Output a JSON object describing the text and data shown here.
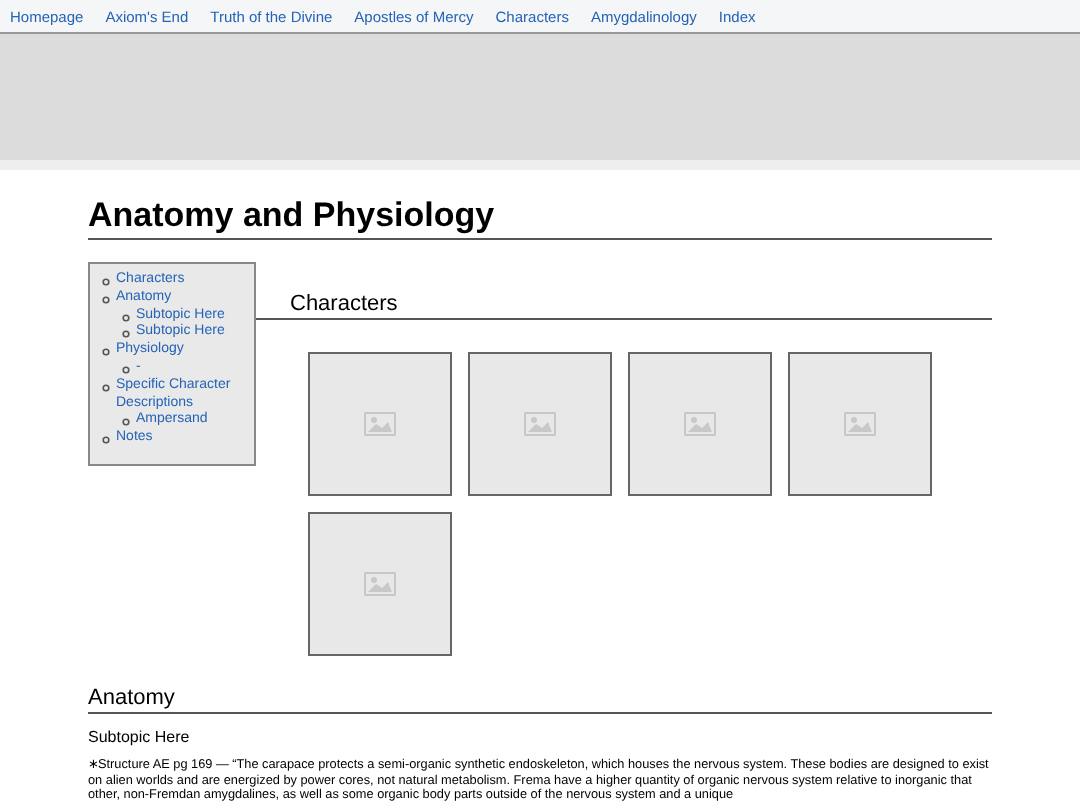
{
  "nav": [
    "Homepage",
    "Axiom's End",
    "Truth of the Divine",
    "Apostles of Mercy",
    "Characters",
    "Amygdalinology",
    "Index"
  ],
  "title": "Anatomy and Physiology",
  "toc": [
    {
      "label": "Characters"
    },
    {
      "label": "Anatomy",
      "children": [
        {
          "label": "Subtopic Here"
        },
        {
          "label": "Subtopic Here"
        }
      ]
    },
    {
      "label": "Physiology",
      "children": [
        {
          "label": "-"
        }
      ]
    },
    {
      "label": "Specific Character Descriptions",
      "children": [
        {
          "label": "Ampersand"
        }
      ]
    },
    {
      "label": "Notes"
    }
  ],
  "characters_heading": "Characters",
  "gallery": [
    {
      "kind": "placeholder"
    },
    {
      "kind": "placeholder"
    },
    {
      "kind": "placeholder"
    },
    {
      "kind": "placeholder"
    },
    {
      "kind": "placeholder"
    }
  ],
  "anatomy_heading": "Anatomy",
  "subtopic": "Subtopic Here",
  "paragraph": {
    "marker": "∗",
    "text": "Structure AE pg 169 — “The carapace protects a semi-organic synthetic endoskeleton, which houses the nervous system. These bodies are designed to exist on alien worlds and are energized by power cores, not natural metabolism. Frema have a higher quantity of organic nervous system relative to inorganic that other, non-Fremdan amygdalines, as well as some organic body parts outside of the nervous system and a unique"
  }
}
